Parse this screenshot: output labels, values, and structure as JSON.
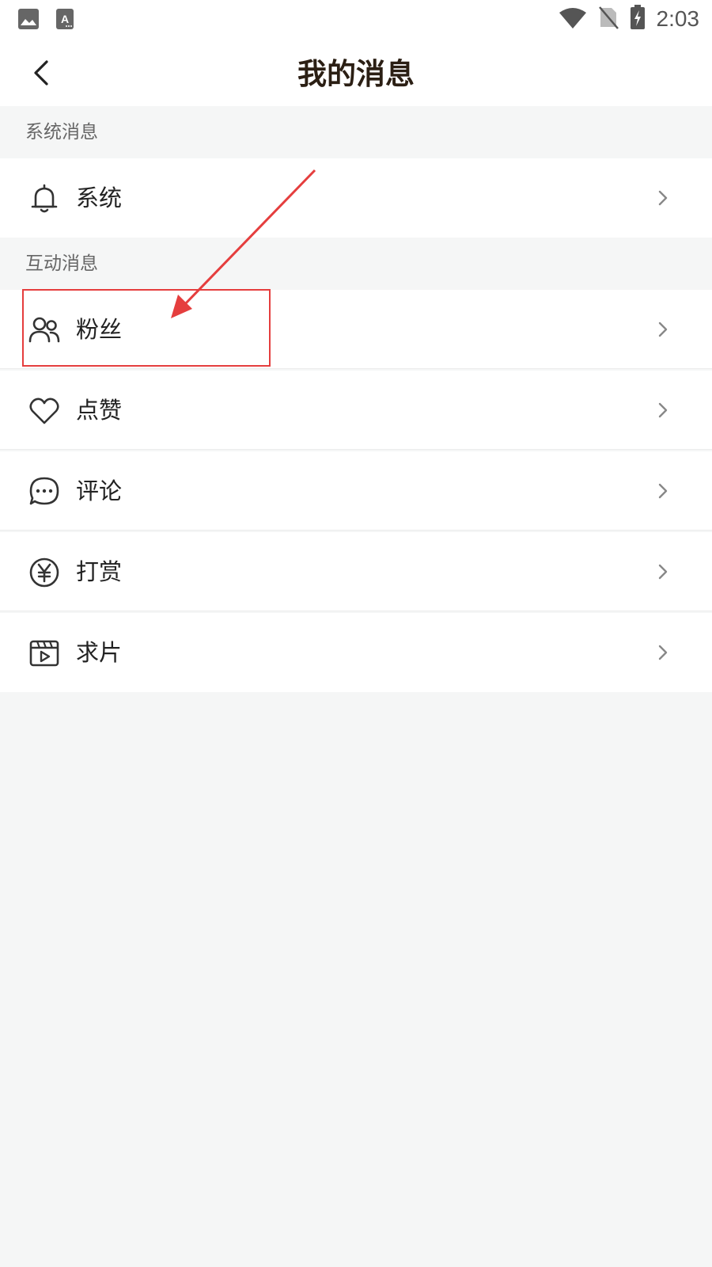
{
  "status_bar": {
    "time": "2:03",
    "left_icons": [
      "image-icon",
      "font-icon"
    ],
    "right_icons": [
      "wifi-icon",
      "no-sim-icon",
      "battery-charging-icon"
    ]
  },
  "nav": {
    "title": "我的消息",
    "back_icon": "back-arrow-icon"
  },
  "sections": [
    {
      "header": "系统消息",
      "items": [
        {
          "label": "系统",
          "icon": "bell-icon"
        }
      ]
    },
    {
      "header": "互动消息",
      "items": [
        {
          "label": "粉丝",
          "icon": "users-icon"
        },
        {
          "label": "点赞",
          "icon": "heart-icon"
        },
        {
          "label": "评论",
          "icon": "chat-bubble-icon"
        },
        {
          "label": "打赏",
          "icon": "yen-coin-icon"
        },
        {
          "label": "求片",
          "icon": "video-clapper-icon"
        }
      ]
    }
  ],
  "annotation": {
    "highlight_color": "#e53e3e",
    "highlighted_item": "粉丝"
  }
}
